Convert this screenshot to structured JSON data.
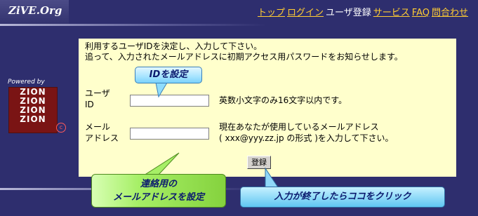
{
  "header": {
    "logo": "ZiVE.Org",
    "nav": {
      "top": "トップ",
      "login": "ログイン",
      "user_register": "ユーザ登録",
      "service": "サービス",
      "faq": "FAQ",
      "contact": "問合わせ"
    }
  },
  "sidebar": {
    "powered_by": "Powered by",
    "zion_lines": [
      "ZION",
      "ZION",
      "ZION",
      "ZION"
    ],
    "copyright_mark": "c"
  },
  "form": {
    "intro": "利用するユーザIDを決定し、入力して下さい。\n追って、入力されたメールアドレスに初期アクセス用パスワードをお知らせします。",
    "user_id": {
      "label_line1": "ユーザ",
      "label_line2": "ID",
      "value": "",
      "note": "英数小文字のみ16文字以内です。"
    },
    "email": {
      "label_line1": "メール",
      "label_line2": "アドレス",
      "value": "",
      "note_line1": "現在あなたが使用しているメールアドレス",
      "note_line2": "( xxx@yyy.zz.jp の形式 )を入力して下さい。"
    },
    "submit_label": "登録"
  },
  "callouts": {
    "id": "IDを設定",
    "mail_line1": "連絡用の",
    "mail_line2": "メールアドレスを設定",
    "click": "入力が終了したらココをクリック"
  },
  "colors": {
    "background": "#2e2e6e",
    "panel": "#ffffcc",
    "nav_link": "#ffcc33",
    "callout_blue": "#a7e4ff",
    "callout_green": "#a6ef66"
  }
}
